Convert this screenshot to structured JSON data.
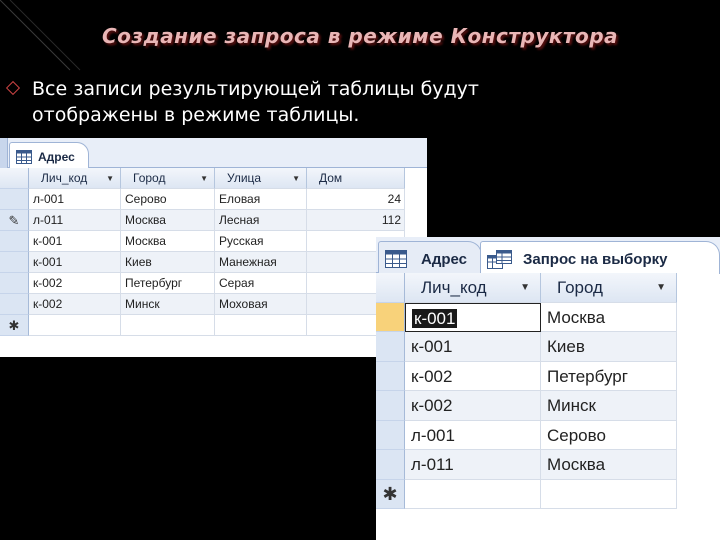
{
  "slide": {
    "title": "Создание запроса в режиме Конструктора",
    "body_line1": "Все записи результирующей таблицы будут",
    "body_line2": "отображены в режиме таблицы."
  },
  "window1": {
    "tab_label": "Адрес",
    "columns": [
      "Лич_код",
      "Город",
      "Улица",
      "Дом"
    ],
    "rows": [
      {
        "code": "л-001",
        "city": "Серово",
        "street": "Еловая",
        "house": "24",
        "marker": ""
      },
      {
        "code": "л-011",
        "city": "Москва",
        "street": "Лесная",
        "house": "112",
        "marker": "✎"
      },
      {
        "code": "к-001",
        "city": "Москва",
        "street": "Русская",
        "house": "",
        "marker": ""
      },
      {
        "code": "к-001",
        "city": "Киев",
        "street": "Манежная",
        "house": "",
        "marker": ""
      },
      {
        "code": "к-002",
        "city": "Петербург",
        "street": "Серая",
        "house": "",
        "marker": ""
      },
      {
        "code": "к-002",
        "city": "Минск",
        "street": "Моховая",
        "house": "",
        "marker": ""
      }
    ],
    "new_row_marker": "✱"
  },
  "window2": {
    "tabs": [
      {
        "label": "Адрес",
        "icon": "table-icon"
      },
      {
        "label": "Запрос на выборку",
        "icon": "query-icon"
      }
    ],
    "columns": [
      "Лич_код",
      "Город"
    ],
    "rows": [
      {
        "code": "к-001",
        "city": "Москва"
      },
      {
        "code": "к-001",
        "city": "Киев"
      },
      {
        "code": "к-002",
        "city": "Петербург"
      },
      {
        "code": "к-002",
        "city": "Минск"
      },
      {
        "code": "л-001",
        "city": "Серово"
      },
      {
        "code": "л-011",
        "city": "Москва"
      }
    ],
    "new_row_marker": "✱"
  },
  "colors": {
    "background": "#000000",
    "title": "#e9b6b6",
    "accent_row": "#f8d27a",
    "header": "#dde6f3"
  }
}
